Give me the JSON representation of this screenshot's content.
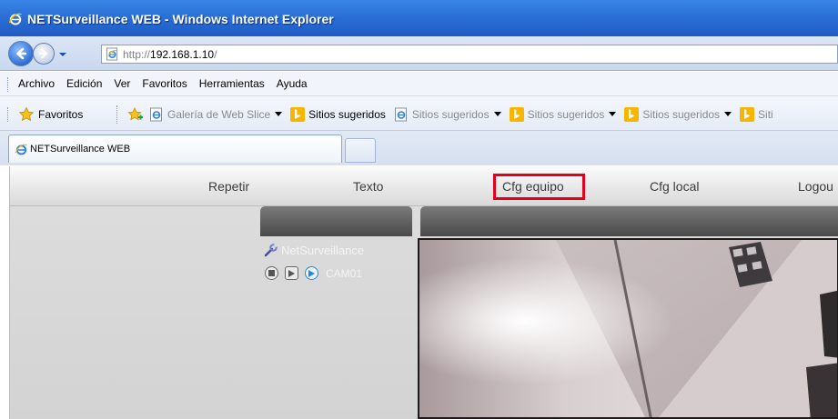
{
  "window": {
    "title": "NETSurveillance WEB - Windows Internet Explorer"
  },
  "address_bar": {
    "url_protocol": "http://",
    "url_host": "192.168.1.10",
    "url_rest": "/"
  },
  "menu": {
    "items": [
      "Archivo",
      "Edición",
      "Ver",
      "Favoritos",
      "Herramientas",
      "Ayuda"
    ]
  },
  "favorites_bar": {
    "favorites_label": "Favoritos",
    "links": [
      {
        "label": "Galería de Web Slice",
        "icon": "ie-page-icon",
        "dropdown": true,
        "dimmed": true
      },
      {
        "label": "Sitios sugeridos",
        "icon": "bing-icon",
        "dropdown": false,
        "dimmed": false
      },
      {
        "label": "Sitios sugeridos",
        "icon": "ie-page-icon",
        "dropdown": true,
        "dimmed": true
      },
      {
        "label": "Sitios sugeridos",
        "icon": "bing-icon",
        "dropdown": true,
        "dimmed": true
      },
      {
        "label": "Sitios sugeridos",
        "icon": "bing-icon",
        "dropdown": true,
        "dimmed": true
      },
      {
        "label": "Siti",
        "icon": "bing-icon",
        "dropdown": false,
        "dimmed": true
      }
    ]
  },
  "tabs": {
    "active_label": "NETSurveillance WEB"
  },
  "app_nav": {
    "repetir": "Repetir",
    "texto": "Texto",
    "cfg_equipo": "Cfg equipo",
    "cfg_local": "Cfg local",
    "logout": "Logou"
  },
  "device_tree": {
    "device_name": "NetSurveillance",
    "camera_label": "CAM01"
  },
  "colors": {
    "highlight": "#e3001b",
    "title_bar": "#2a6fd6",
    "live_icon": "#2a86d6"
  }
}
